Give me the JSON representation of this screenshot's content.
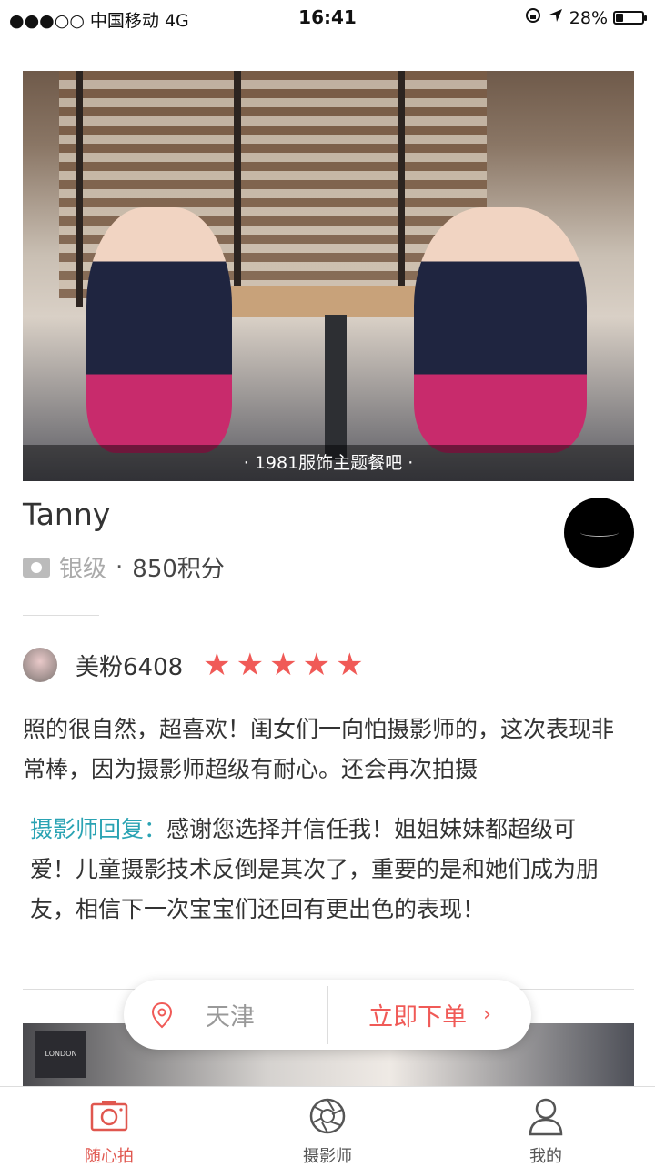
{
  "status_bar": {
    "carrier": "●●●○○ 中国移动   4G",
    "time": "16:41",
    "battery_text": "28%",
    "battery_level": 0.28,
    "icons": [
      "lock-rotation-icon",
      "location-arrow-icon",
      "battery-icon"
    ]
  },
  "photo": {
    "caption": "· 1981服饰主题餐吧 ·"
  },
  "photographer": {
    "name": "Tanny",
    "level": "银级",
    "separator": "·",
    "points": "850积分"
  },
  "review": {
    "reviewer": "美粉6408",
    "rating": 5,
    "stars": [
      "★",
      "★",
      "★",
      "★",
      "★"
    ],
    "text": "照的很自然，超喜欢！闺女们一向怕摄影师的，这次表现非常棒，因为摄影师超级有耐心。还会再次拍摄",
    "reply_label": "摄影师回复：",
    "reply_text": "感谢您选择并信任我！姐姐妹妹都超级可爱！儿童摄影技术反倒是其次了，重要的是和她们成为朋友，相信下一次宝宝们还回有更出色的表现！"
  },
  "photo2": {
    "sign_text": "LONDON"
  },
  "action_bar": {
    "city": "天津",
    "order_label": "立即下单",
    "chevron": "›"
  },
  "tabs": [
    {
      "label": "随心拍",
      "icon": "camera-icon",
      "active": true
    },
    {
      "label": "摄影师",
      "icon": "aperture-icon",
      "active": false
    },
    {
      "label": "我的",
      "icon": "user-icon",
      "active": false
    }
  ],
  "colors": {
    "accent": "#f05a57",
    "reply_tag": "#2aa3b3",
    "tab_active": "#e0574f"
  }
}
